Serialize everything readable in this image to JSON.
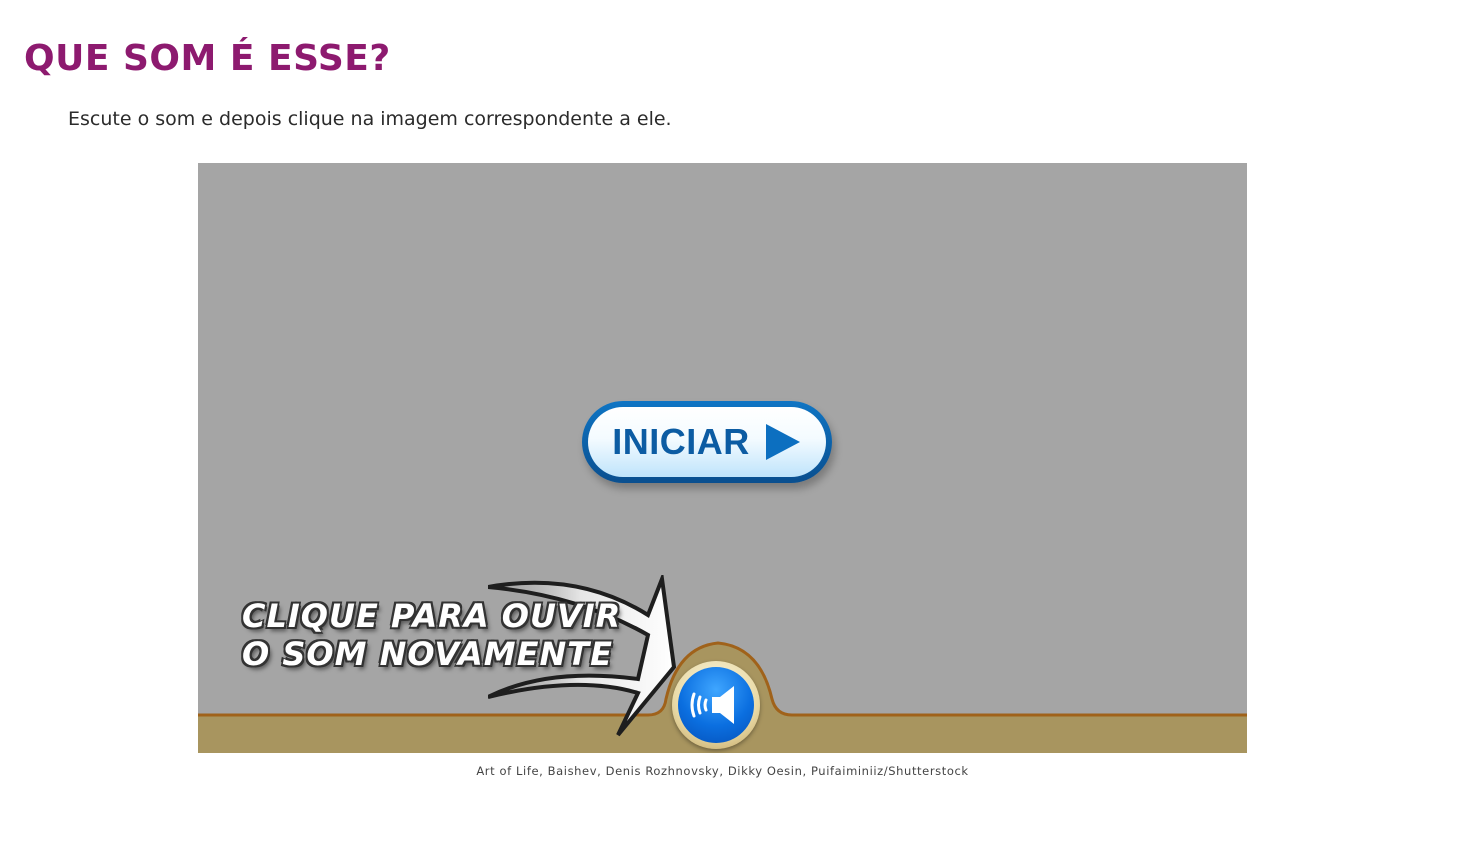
{
  "header": {
    "title": "QUE SOM É ESSE?",
    "instruction": "Escute o som e depois clique na imagem correspondente a ele."
  },
  "activity": {
    "start_button_label": "INICIAR",
    "start_icon": "play-triangle-icon",
    "replay_hint_line1": "CLIQUE PARA OUVIR",
    "replay_hint_line2": "O SOM NOVAMENTE",
    "sound_icon": "speaker-icon",
    "colors": {
      "stage_bg": "#a5a5a5",
      "floor": "#a8955f",
      "floor_line": "#a0621a",
      "button_blue": "#0c5ca3",
      "title_purple": "#8d1a6f"
    }
  },
  "footer": {
    "credits": "Art of Life, Baishev, Denis Rozhnovsky, Dikky Oesin, Puifaiminiiz/Shutterstock"
  }
}
